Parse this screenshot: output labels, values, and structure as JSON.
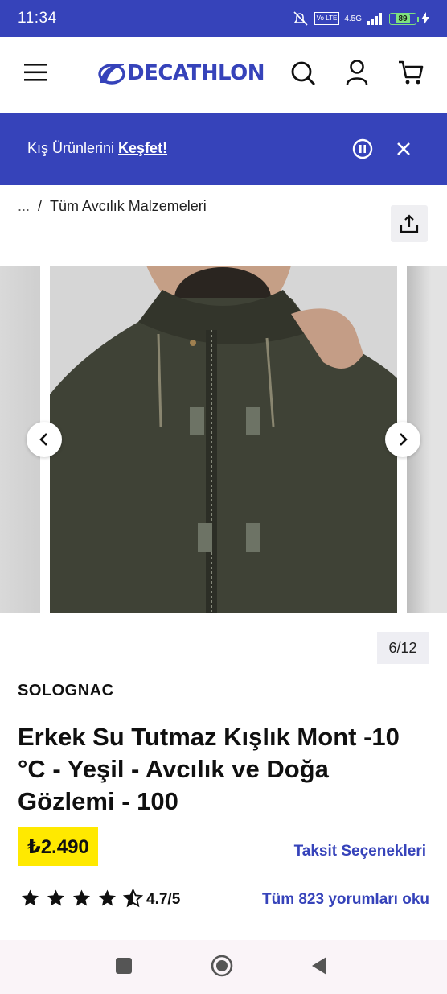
{
  "status": {
    "time": "11:34",
    "network": "4.5G",
    "battery": "89"
  },
  "header": {
    "logo": "DECATHLON"
  },
  "banner": {
    "text": "Kış Ürünlerini ",
    "link": "Keşfet!"
  },
  "breadcrumb": {
    "ellipsis": "...",
    "separator": "/",
    "current": "Tüm Avcılık Malzemeleri"
  },
  "gallery": {
    "counter": "6/12"
  },
  "product": {
    "brand": "SOLOGNAC",
    "title": "Erkek Su Tutmaz Kışlık Mont -10 °C - Yeşil - Avcılık ve Doğa Gözlemi - 100",
    "price": "₺2.490",
    "installments": "Taksit Seçenekleri",
    "rating": "4.7/5",
    "rating_value": 4.7,
    "reviews": "Tüm 823 yorumları oku"
  },
  "colors": {
    "brand": "#3643ba",
    "price_bg": "#ffe900"
  }
}
